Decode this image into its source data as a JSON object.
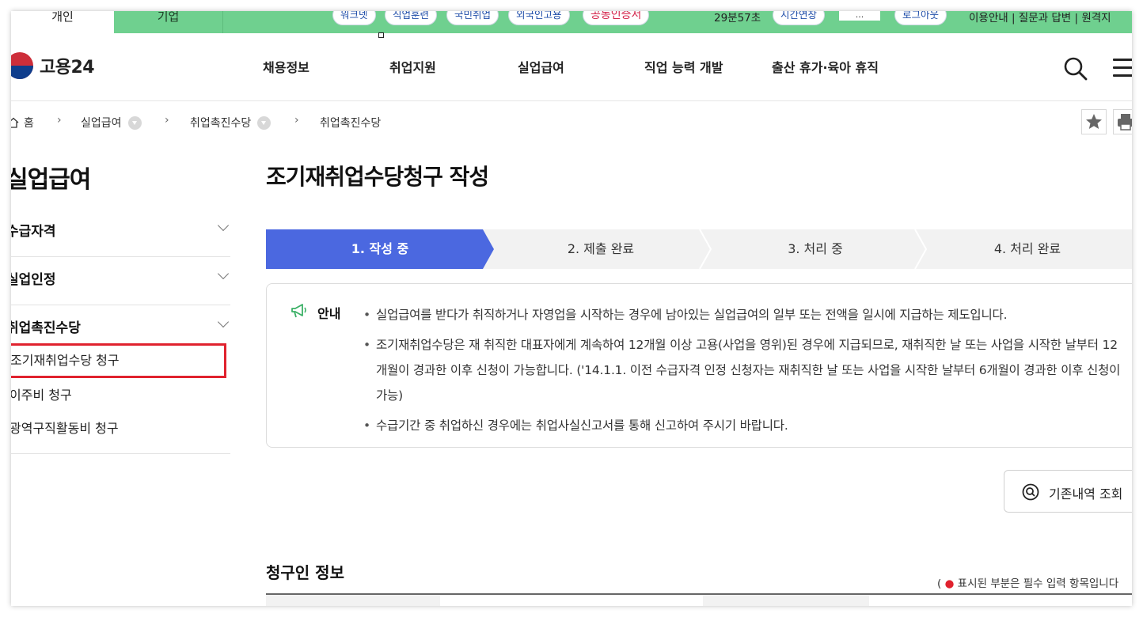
{
  "util_bar": {
    "tab_personal": "개인",
    "tab_business": "기업",
    "pills": [
      "워크넷",
      "직업훈련",
      "국민취업",
      "외국인고용",
      "공동인증서"
    ],
    "timer": "29분57초",
    "extend_label": "시간연장",
    "user_label": "...",
    "logout_label": "로그아웃",
    "links": "이용안내 | 질문과 답변 | 원격지"
  },
  "header": {
    "logo_text": "고용24",
    "nav": [
      "채용정보",
      "취업지원",
      "실업급여",
      "직업 능력 개발",
      "출산 휴가·육아 휴직"
    ]
  },
  "breadcrumb": {
    "home": "홈",
    "items": [
      "실업급여",
      "취업촉진수당",
      "취업촉진수당"
    ]
  },
  "sidebar": {
    "title": "실업급여",
    "sections": [
      "수급자격",
      "실업인정",
      "취업촉진수당"
    ],
    "sub_items": [
      "조기재취업수당 청구",
      "이주비 청구",
      "광역구직활동비 청구"
    ],
    "active_item": "조기재취업수당 청구"
  },
  "main": {
    "page_title": "조기재취업수당청구 작성",
    "steps": [
      "1. 작성 중",
      "2. 제출 완료",
      "3. 처리 중",
      "4. 처리 완료"
    ],
    "current_step": 1,
    "notice": {
      "head": "안내",
      "items": [
        "실업급여를 받다가 취직하거나 자영업을 시작하는 경우에 남아있는 실업급여의 일부 또는 전액을 일시에 지급하는 제도입니다.",
        "조기재취업수당은 재 취직한 대표자에게 계속하여 12개월 이상 고용(사업을 영위)된 경우에 지급되므로, 재취직한 날 또는 사업을 시작한 날부터 12개월이 경과한 이후 신청이 가능합니다. ('14.1.1. 이전 수급자격 인정 신청자는 재취직한 날 또는 사업을 시작한 날부터 6개월이 경과한 이후 신청이 가능)",
        "수급기간 중 취업하신 경우에는 취업사실신고서를 통해 신고하여 주시기 바랍니다."
      ]
    },
    "history_button": "기존내역 조회",
    "section_title": "청구인 정보",
    "required_note": "표시된 부분은 필수 입력 항목입니다",
    "required_open": "(",
    "required_dot": "●"
  },
  "colors": {
    "util_green": "#6fd08f",
    "step_active": "#4b68e0",
    "highlight_red": "#e0222e",
    "pill_red": "#d3254a"
  }
}
